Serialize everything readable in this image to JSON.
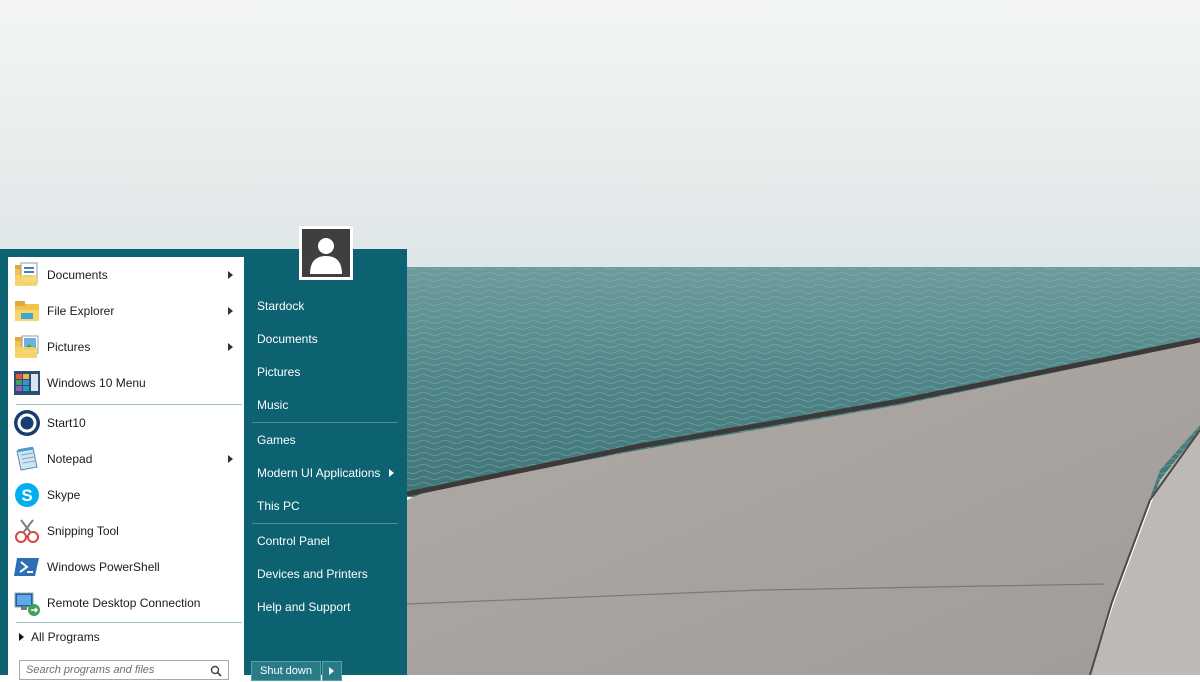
{
  "colors": {
    "menu_background": "#0c6270",
    "left_pane_background": "#ffffff",
    "right_text": "#ffffff"
  },
  "pinned": [
    {
      "label": "Documents",
      "icon": "documents-folder-icon",
      "has_submenu": true
    },
    {
      "label": "File Explorer",
      "icon": "file-explorer-icon",
      "has_submenu": true
    },
    {
      "label": "Pictures",
      "icon": "pictures-folder-icon",
      "has_submenu": true
    },
    {
      "label": "Windows 10 Menu",
      "icon": "windows-10-menu-icon",
      "has_submenu": false
    }
  ],
  "recent": [
    {
      "label": "Start10",
      "icon": "start10-icon",
      "has_submenu": false
    },
    {
      "label": "Notepad",
      "icon": "notepad-icon",
      "has_submenu": true
    },
    {
      "label": "Skype",
      "icon": "skype-icon",
      "has_submenu": false
    },
    {
      "label": "Snipping Tool",
      "icon": "snipping-tool-icon",
      "has_submenu": false
    },
    {
      "label": "Windows PowerShell",
      "icon": "powershell-icon",
      "has_submenu": false
    },
    {
      "label": "Remote Desktop Connection",
      "icon": "remote-desktop-icon",
      "has_submenu": false
    }
  ],
  "all_programs_label": "All Programs",
  "search": {
    "placeholder": "Search programs and files"
  },
  "right_pane": {
    "user": "Stardock",
    "items": [
      {
        "label": "Documents",
        "has_submenu": false
      },
      {
        "label": "Pictures",
        "has_submenu": false
      },
      {
        "label": "Music",
        "has_submenu": false
      },
      {
        "label": "Games",
        "has_submenu": false
      },
      {
        "label": "Modern UI Applications",
        "has_submenu": true
      },
      {
        "label": "This PC",
        "has_submenu": false
      },
      {
        "label": "Control Panel",
        "has_submenu": false
      },
      {
        "label": "Devices and Printers",
        "has_submenu": false
      },
      {
        "label": "Help and Support",
        "has_submenu": false
      }
    ],
    "shutdown_label": "Shut down"
  }
}
